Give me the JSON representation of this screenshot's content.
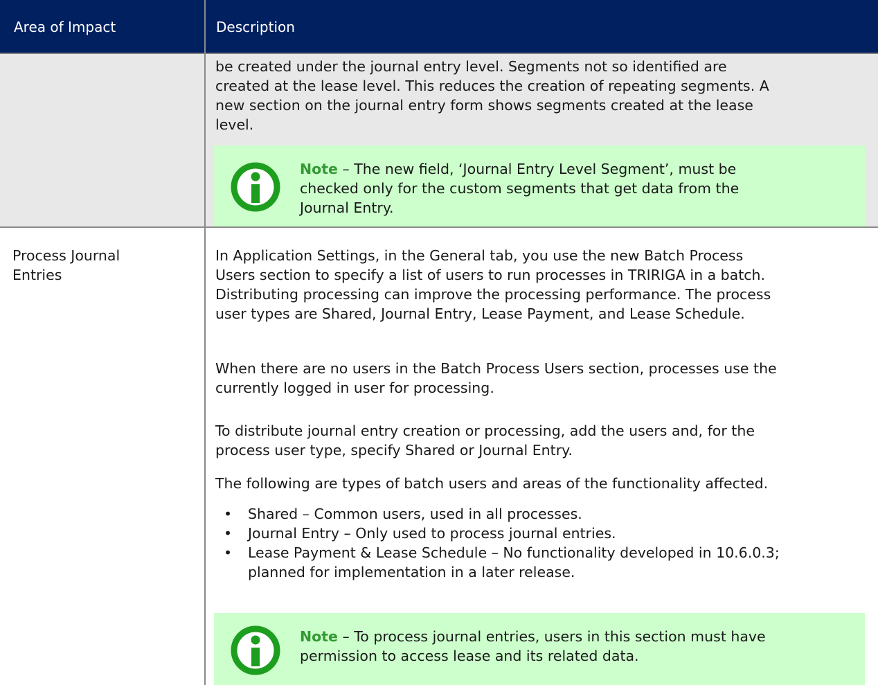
{
  "header": {
    "col1": "Area of Impact",
    "col2": "Description"
  },
  "row1": {
    "text_lines": [
      "be created under the journal entry level. Segments not so identified are",
      "created at the lease level. This reduces the creation of repeating segments. A",
      "new section on the journal entry form shows segments created at the lease",
      "level."
    ],
    "note": {
      "label": "Note",
      "lines": [
        " – The new field, ‘Journal Entry Level Segment’, must be",
        "checked only for the custom segments that get data from the",
        "Journal Entry."
      ]
    }
  },
  "row2": {
    "area_lines": [
      "Process Journal",
      "Entries"
    ],
    "para1_lines": [
      "In Application Settings, in the General tab, you use the new Batch Process",
      "Users section to specify a list of users to run processes in TRIRIGA in a batch.",
      "Distributing processing can improve the processing performance. The process",
      "user types are Shared, Journal Entry, Lease Payment, and Lease Schedule."
    ],
    "para2_lines": [
      "When there are no users in the Batch Process Users section, processes use the",
      "currently logged in user for processing."
    ],
    "para3_lines": [
      "To distribute journal entry creation or processing, add the users and, for the",
      "process user type, specify Shared or Journal Entry."
    ],
    "para4": "The following are types of batch users and areas of the functionality affected.",
    "bullets": [
      [
        "Shared – Common users, used in all processes."
      ],
      [
        "Journal Entry – Only used to process journal entries."
      ],
      [
        "Lease Payment & Lease Schedule – No functionality developed in 10.6.0.3;",
        "planned for implementation in a later release."
      ]
    ],
    "bullet_glyph": "•",
    "note": {
      "label": "Note",
      "lines": [
        " – To process journal entries, users in this section must have",
        "permission to access lease and its related data."
      ]
    }
  },
  "colors": {
    "header_bg": "#002060",
    "row_shade": "#e8e8e8",
    "note_bg": "#ccffcc",
    "note_accent": "#339933",
    "icon_green": "#1e9e1e"
  }
}
